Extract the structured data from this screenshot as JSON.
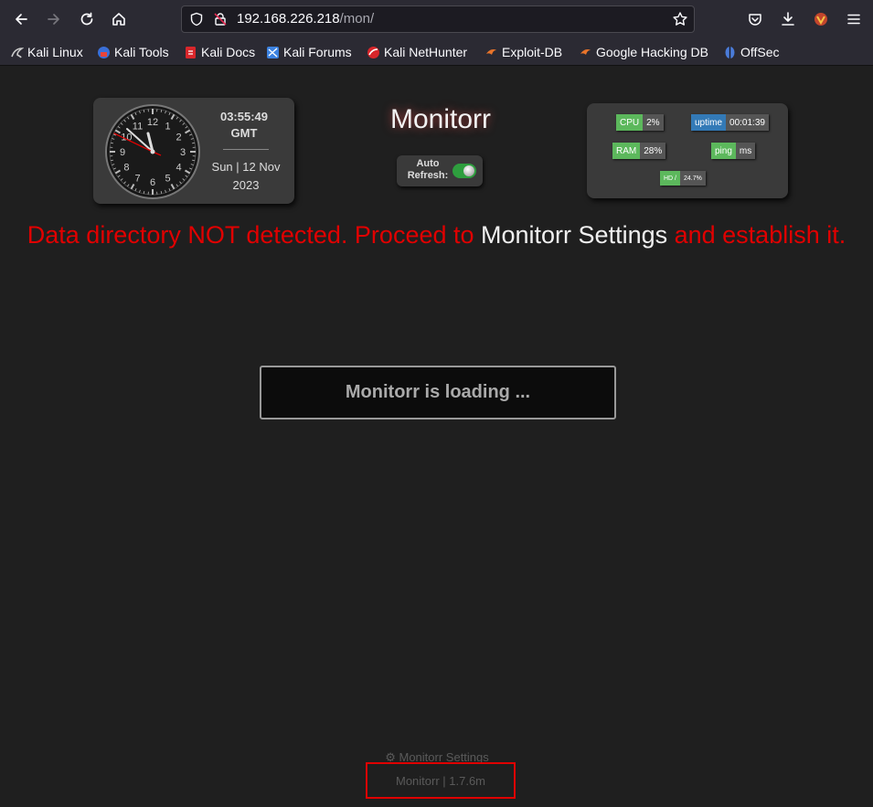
{
  "browser": {
    "url_host": "192.168.226.218",
    "url_path": "/mon/",
    "bookmarks": [
      {
        "label": "Kali Linux",
        "icon": "kali-dragon-icon"
      },
      {
        "label": "Kali Tools",
        "icon": "kali-tools-icon"
      },
      {
        "label": "Kali Docs",
        "icon": "kali-docs-icon"
      },
      {
        "label": "Kali Forums",
        "icon": "kali-forums-icon"
      },
      {
        "label": "Kali NetHunter",
        "icon": "nethunter-icon"
      },
      {
        "label": "Exploit-DB",
        "icon": "exploit-db-icon"
      },
      {
        "label": "Google Hacking DB",
        "icon": "ghdb-icon"
      },
      {
        "label": "OffSec",
        "icon": "offsec-icon"
      }
    ]
  },
  "clock": {
    "time": "03:55:49",
    "timezone": "GMT",
    "date_line1": "Sun | 12 Nov",
    "date_line2": "2023",
    "numerals": [
      "12",
      "1",
      "2",
      "3",
      "4",
      "5",
      "6",
      "7",
      "8",
      "9",
      "10",
      "11"
    ]
  },
  "header": {
    "title": "Monitorr",
    "auto_refresh_label": "Auto Refresh:"
  },
  "stats": {
    "cpu_label": "CPU",
    "cpu_value": "2%",
    "uptime_label": "uptime",
    "uptime_value": "00:01:39",
    "ram_label": "RAM",
    "ram_value": "28%",
    "ping_label": "ping",
    "ping_value": "ms",
    "hd_label": "HD /",
    "hd_value": "24.7%"
  },
  "error": {
    "part1": "Data directory NOT detected. Proceed to ",
    "link": "Monitorr Settings",
    "part2": " and establish it."
  },
  "loading_text": "Monitorr is loading ...",
  "footer": {
    "settings_link": "Monitorr Settings",
    "version": "Monitorr | 1.7.6m"
  },
  "colors": {
    "error_red": "#e00000",
    "stat_green": "#5cb85c",
    "stat_blue": "#337ab7",
    "toggle_on": "#2e9e3e"
  }
}
